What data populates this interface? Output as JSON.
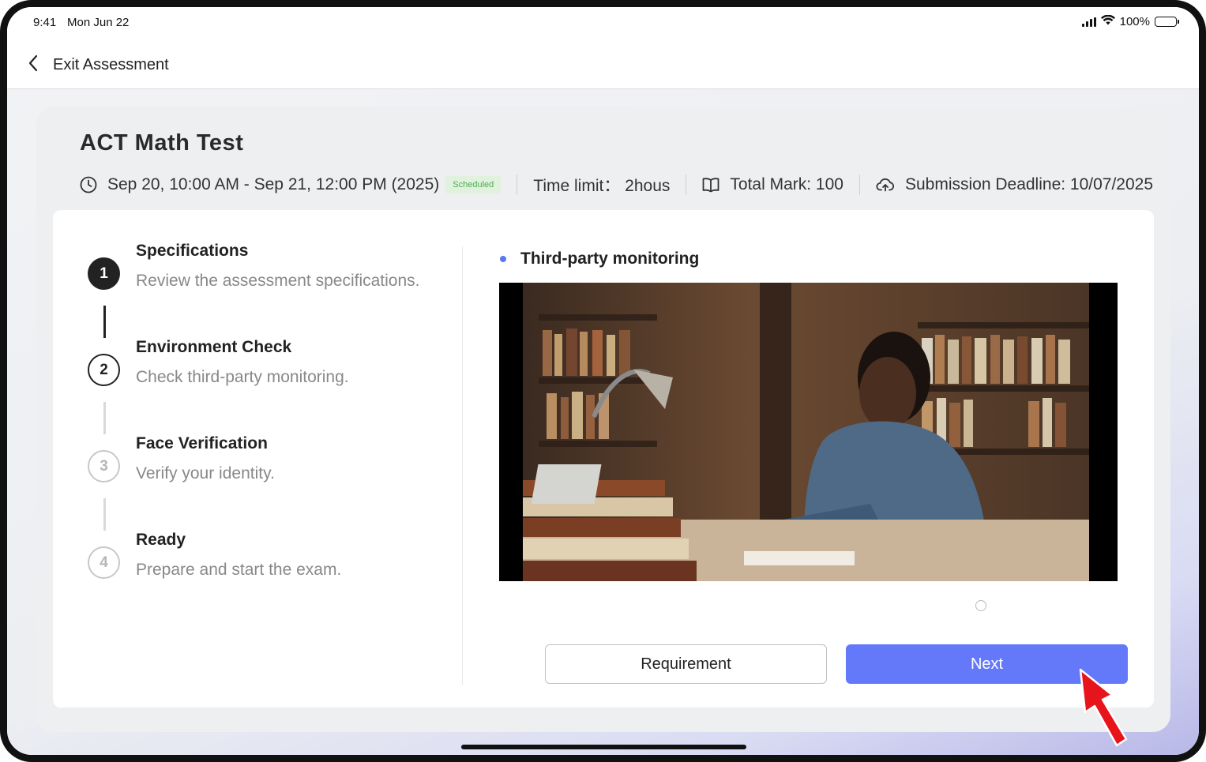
{
  "status": {
    "time": "9:41",
    "date": "Mon Jun 22",
    "battery": "100%"
  },
  "nav": {
    "back_label": "Exit Assessment"
  },
  "test": {
    "title": "ACT Math Test",
    "schedule": "Sep 20, 10:00 AM - Sep 21, 12:00 PM (2025)",
    "badge": "Scheduled",
    "time_limit": "Time limit： 2hous",
    "total_mark": "Total Mark: 100",
    "deadline": "Submission Deadline: 10/07/2025"
  },
  "steps": [
    {
      "number": "1",
      "title": "Specifications",
      "desc": "Review the assessment specifications.",
      "state": "completed"
    },
    {
      "number": "2",
      "title": "Environment Check",
      "desc": "Check third-party monitoring.",
      "state": "current"
    },
    {
      "number": "3",
      "title": "Face Verification",
      "desc": "Verify your identity.",
      "state": "pending"
    },
    {
      "number": "4",
      "title": "Ready",
      "desc": "Prepare and start the exam.",
      "state": "pending"
    }
  ],
  "monitoring": {
    "heading": "Third-party monitoring"
  },
  "buttons": {
    "requirement": "Requirement",
    "next": "Next"
  },
  "colors": {
    "accent": "#6478fa",
    "badge_green": "#4caf50",
    "bullet": "#5a78f5"
  },
  "icons": [
    "chevron-left-icon",
    "clock-icon",
    "book-icon",
    "cloud-upload-icon",
    "signal-icon",
    "wifi-icon",
    "battery-icon",
    "cursor-arrow-icon"
  ]
}
